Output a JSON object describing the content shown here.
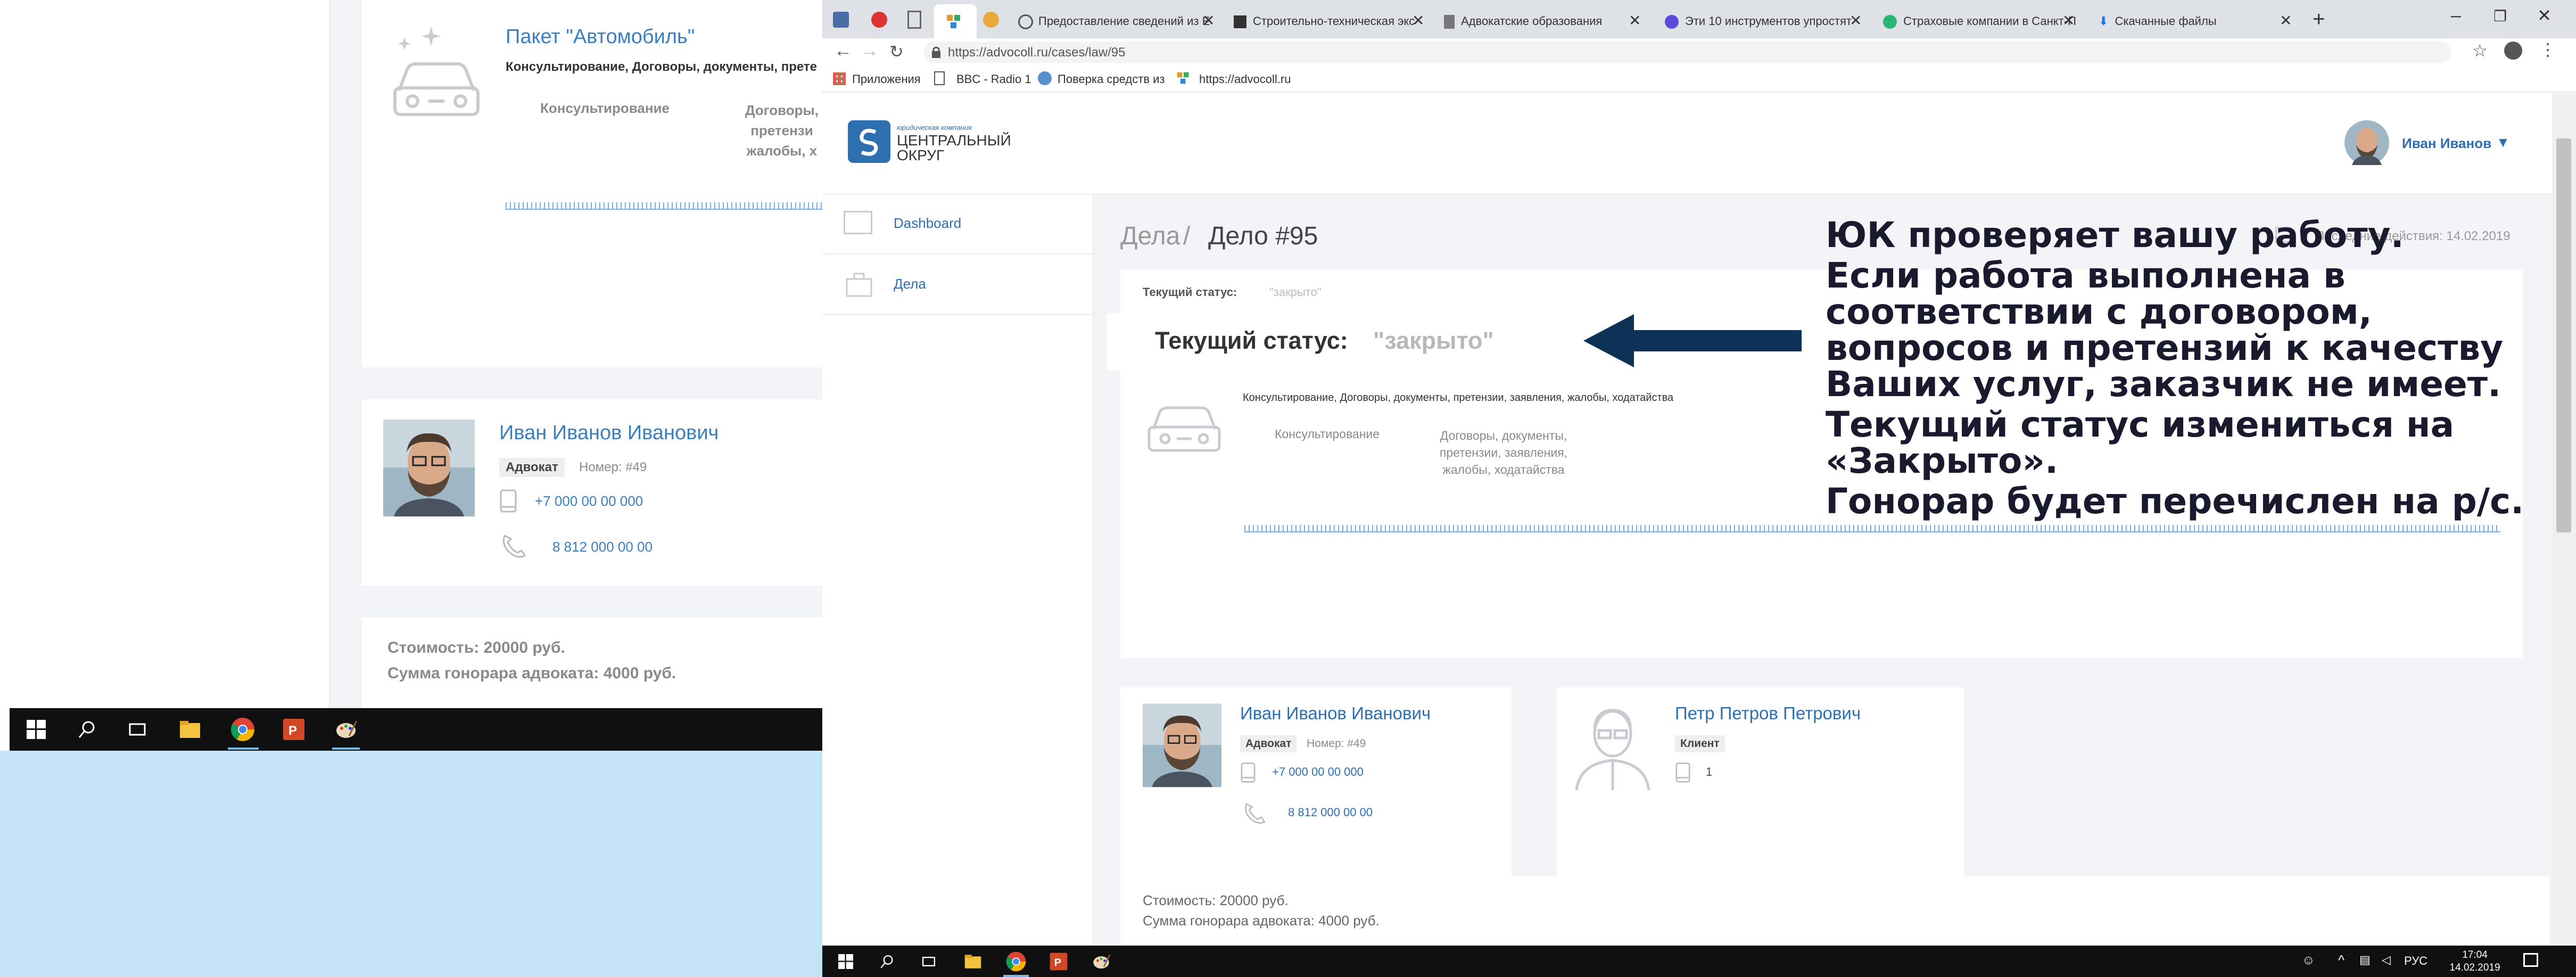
{
  "bg_window": {
    "package_title": "Пакет \"Автомобиль\"",
    "package_desc": "Консультирование, Договоры, документы, прете",
    "col1": "Консультирование",
    "col2": [
      "Договоры,",
      "претензи",
      "жалобы, х"
    ],
    "lawyer": {
      "name": "Иван Иванов Иванович",
      "role": "Адвокат",
      "number": "Номер: #49",
      "phone1": "+7 000 00 00 000",
      "phone2": "8 812 000 00 00"
    },
    "cost": "Стоимость: 20000 руб.",
    "fee": "Сумма гонорара адвоката: 4000 руб."
  },
  "browser": {
    "tabs": [
      {
        "label": "Предоставление сведений из Е"
      },
      {
        "label": "Строительно-техническая экс"
      },
      {
        "label": "Адвокатские образования"
      },
      {
        "label": "Эти 10 инструментов упростят"
      },
      {
        "label": "Страховые компании в Санкт-П"
      },
      {
        "label": "Скачанные файлы"
      }
    ],
    "url": "https://advocoll.ru/cases/law/95",
    "bookmarks": [
      "Приложения",
      "BBC - Radio 1",
      "Поверка средств из",
      "https://advocoll.ru"
    ]
  },
  "site": {
    "logo_small": "юридическая компания",
    "logo_line1": "ЦЕНТРАЛЬНЫЙ",
    "logo_line2": "ОКРУГ",
    "user_name": "Иван Иванов",
    "nav": [
      {
        "label": "Dashboard"
      },
      {
        "label": "Дела"
      }
    ],
    "breadcrumb_root": "Дела",
    "breadcrumb_sep": "/",
    "breadcrumb_current": "Дело #95",
    "last_action": "Последние действия: 14.02.2019",
    "status_small_label": "Текущий статус:",
    "status_small_value": "\"закрыто\"",
    "status_label": "Текущий статус:",
    "status_value": "\"закрыто\"",
    "package_desc": "Консультирование, Договоры, документы, претензии, заявления, жалобы, ходатайства",
    "col1": "Консультирование",
    "col2": [
      "Договоры, документы,",
      "претензии, заявления,",
      "жалобы, ходатайства"
    ],
    "lawyer": {
      "name": "Иван Иванов Иванович",
      "role": "Адвокат",
      "number": "Номер: #49",
      "phone1": "+7 000 00 00 000",
      "phone2": "8 812 000 00 00"
    },
    "client": {
      "name": "Петр Петров Петрович",
      "role": "Клиент",
      "phone": "1"
    },
    "cost": "Стоимость: 20000 руб.",
    "fee": "Сумма гонорара адвоката: 4000 руб."
  },
  "annotation": {
    "line1": "ЮК проверяет вашу работу.",
    "para2": [
      "Если работа выполнена в",
      "соответствии с договором,",
      "вопросов и претензий к качеству",
      "Ваших услуг, заказчик не имеет."
    ],
    "para3": [
      "Текущий статус измениться на",
      "«Закрыто»."
    ],
    "line4": "Гонорар будет перечислен на р/с."
  },
  "tray": {
    "lang": "РУС",
    "time": "17:04",
    "date": "14.02.2019"
  },
  "colors": {
    "accent": "#3b7fbf",
    "arrow": "#0e3158",
    "annotation_text": "#1a1a2e",
    "taskbar": "#101010",
    "light_blue_bg": "#c5e3f6"
  }
}
